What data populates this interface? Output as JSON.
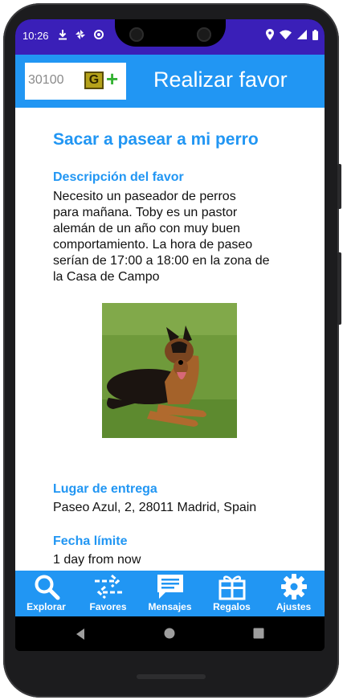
{
  "status_bar": {
    "time": "10:26"
  },
  "app_bar": {
    "coins": "30100",
    "coin_icon_letter": "G",
    "add_coins_symbol": "+",
    "title": "Realizar favor"
  },
  "favor": {
    "title": "Sacar a pasear a mi perro",
    "description_label": "Descripción del favor",
    "description_lines": [
      "Necesito un paseador de perros",
      "para mañana. Toby es un pastor",
      "alemán de un año con muy buen",
      "comportamiento. La hora de paseo",
      "serían de 17:00 a 18:00 en la zona de",
      "la Casa de Campo"
    ],
    "location_label": "Lugar de entrega",
    "location": "Paseo Azul, 2, 28011 Madrid, Spain",
    "deadline_label": "Fecha límite",
    "deadline": "1 day from now"
  },
  "bottom_nav": [
    {
      "label": "Explorar",
      "icon": "search-icon"
    },
    {
      "label": "Favores",
      "icon": "swap-arrows-icon"
    },
    {
      "label": "Mensajes",
      "icon": "message-icon"
    },
    {
      "label": "Regalos",
      "icon": "gift-icon"
    },
    {
      "label": "Ajustes",
      "icon": "gear-icon"
    }
  ],
  "colors": {
    "status_bar": "#3a1fb8",
    "accent": "#2196f3",
    "coin_icon": "#b5a21a",
    "plus": "#34b233"
  }
}
